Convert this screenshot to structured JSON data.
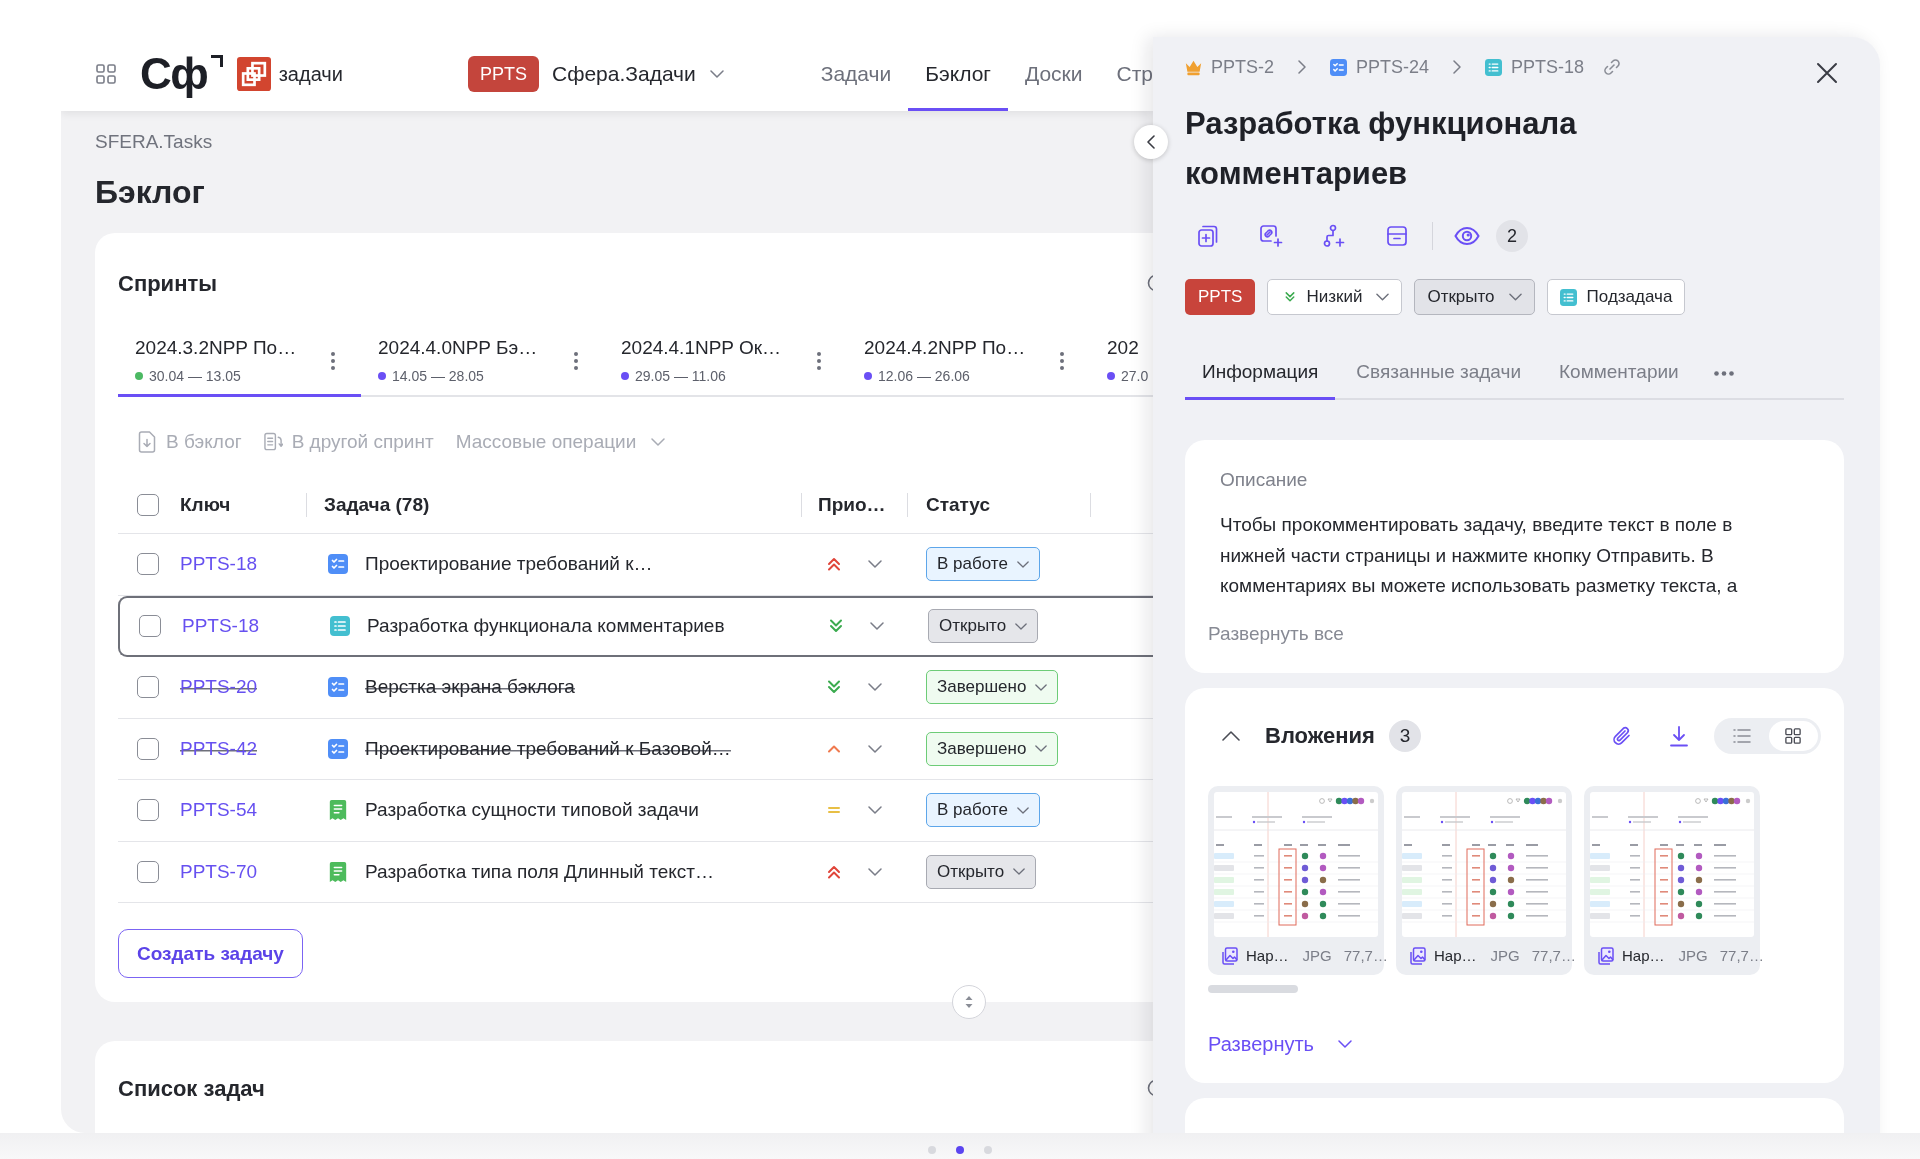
{
  "header": {
    "logo_text": "Сф",
    "product": "задачи",
    "project": {
      "badge": "PPTS",
      "name": "Сфера.Задачи"
    },
    "nav": [
      {
        "label": "Задачи",
        "selected": false
      },
      {
        "label": "Бэклог",
        "selected": true
      },
      {
        "label": "Доски",
        "selected": false
      },
      {
        "label": "Стр",
        "selected": false
      }
    ]
  },
  "page": {
    "breadcrumb": "SFERA.Tasks",
    "title": "Бэклог"
  },
  "sprints": {
    "title": "Спринты",
    "tabs": [
      {
        "name": "2024.3.2NPP По…",
        "dates": "30.04 — 13.05",
        "color": "#4cb963",
        "menu": true,
        "selected": true
      },
      {
        "name": "2024.4.0NPP Бэ…",
        "dates": "14.05 — 28.05",
        "color": "#6a4ff5",
        "menu": true,
        "selected": false
      },
      {
        "name": "2024.4.1NPP Ок…",
        "dates": "29.05 — 11.06",
        "color": "#6a4ff5",
        "menu": true,
        "selected": false
      },
      {
        "name": "2024.4.2NPP По…",
        "dates": "12.06 — 26.06",
        "color": "#6a4ff5",
        "menu": true,
        "selected": false
      },
      {
        "name": "202",
        "dates": "27.0",
        "color": "#6a4ff5",
        "menu": false,
        "selected": false
      }
    ],
    "toolbar": [
      {
        "label": "В бэклог",
        "kind": "to_backlog",
        "disabled": true
      },
      {
        "label": "В другой спринт",
        "kind": "to_sprint",
        "disabled": true
      },
      {
        "label": "Массовые операции",
        "kind": "menu",
        "disabled": true
      }
    ],
    "table": {
      "columns": [
        "Ключ",
        "Задача (78)",
        "Прио…",
        "Статус"
      ],
      "header_checked": false,
      "rows": [
        {
          "checked": false,
          "selected": false,
          "key": "PPTS-18",
          "type": {
            "kind": "task"
          },
          "title": "Проектирование требований к…",
          "priority": {
            "kind": "highest"
          },
          "status": {
            "label": "В работе",
            "kind": "in_progress"
          }
        },
        {
          "checked": false,
          "selected": true,
          "key": "PPTS-18",
          "type": {
            "kind": "subtask"
          },
          "title": "Разработка функционала комментариев",
          "priority": {
            "kind": "lowest"
          },
          "status": {
            "label": "Открыто",
            "kind": "open"
          }
        },
        {
          "checked": false,
          "selected": false,
          "key": "PPTS-20",
          "type": {
            "kind": "task"
          },
          "title": "Верстка экрана бэклога",
          "priority": {
            "kind": "lowest"
          },
          "status": {
            "label": "Завершено",
            "kind": "done"
          }
        },
        {
          "checked": false,
          "selected": false,
          "key": "PPTS-42",
          "type": {
            "kind": "task"
          },
          "title": "Проектирование требований к Базовой…",
          "priority": {
            "kind": "high"
          },
          "status": {
            "label": "Завершено",
            "kind": "done"
          }
        },
        {
          "checked": false,
          "selected": false,
          "key": "PPTS-54",
          "type": {
            "kind": "story"
          },
          "title": "Разработка сущности типовой задачи",
          "priority": {
            "kind": "medium"
          },
          "status": {
            "label": "В работе",
            "kind": "in_progress"
          }
        },
        {
          "checked": false,
          "selected": false,
          "key": "PPTS-70",
          "type": {
            "kind": "story"
          },
          "title": "Разработка типа поля Длинный текст…",
          "priority": {
            "kind": "highest"
          },
          "status": {
            "label": "Открыто",
            "kind": "open"
          }
        }
      ]
    },
    "create_button": "Создать задачу"
  },
  "task_list": {
    "title": "Список задач"
  },
  "panel": {
    "breadcrumbs": [
      {
        "key": "PPTS-2",
        "kind": "epic"
      },
      {
        "key": "PPTS-24",
        "kind": "task"
      },
      {
        "key": "PPTS-18",
        "kind": "subtask"
      }
    ],
    "title": "Разработка функционала комментариев",
    "watchers": "2",
    "project": "PPTS",
    "priority": {
      "label": "Низкий",
      "kind": "lowest"
    },
    "status": {
      "label": "Открыто",
      "kind": "open"
    },
    "issue_type": {
      "label": "Подзадача",
      "kind": "subtask"
    },
    "tabs": [
      {
        "label": "Информация",
        "selected": true
      },
      {
        "label": "Связанные задачи",
        "selected": false
      },
      {
        "label": "Комментарии",
        "selected": false
      }
    ],
    "description": {
      "label": "Описание",
      "text": "Чтобы прокомментировать задачу, введите текст в поле в нижней части страницы и нажмите кнопку Отправить. В комментариях вы можете использовать разметку текста, а",
      "expand": "Развернуть все"
    },
    "attachments": {
      "title": "Вложения",
      "count": "3",
      "expanded": true,
      "views": [
        {
          "kind": "list",
          "selected": false
        },
        {
          "kind": "grid",
          "selected": true
        }
      ],
      "files": [
        {
          "name": "Нар…",
          "ext": "JPG",
          "size": "77,7…"
        },
        {
          "name": "Нар…",
          "ext": "JPG",
          "size": "77,7…"
        },
        {
          "name": "Нар…",
          "ext": "JPG",
          "size": "77,7…"
        }
      ],
      "expand": "Развернуть"
    }
  },
  "carousel": [
    {
      "selected": false
    },
    {
      "selected": true
    },
    {
      "selected": false
    }
  ]
}
